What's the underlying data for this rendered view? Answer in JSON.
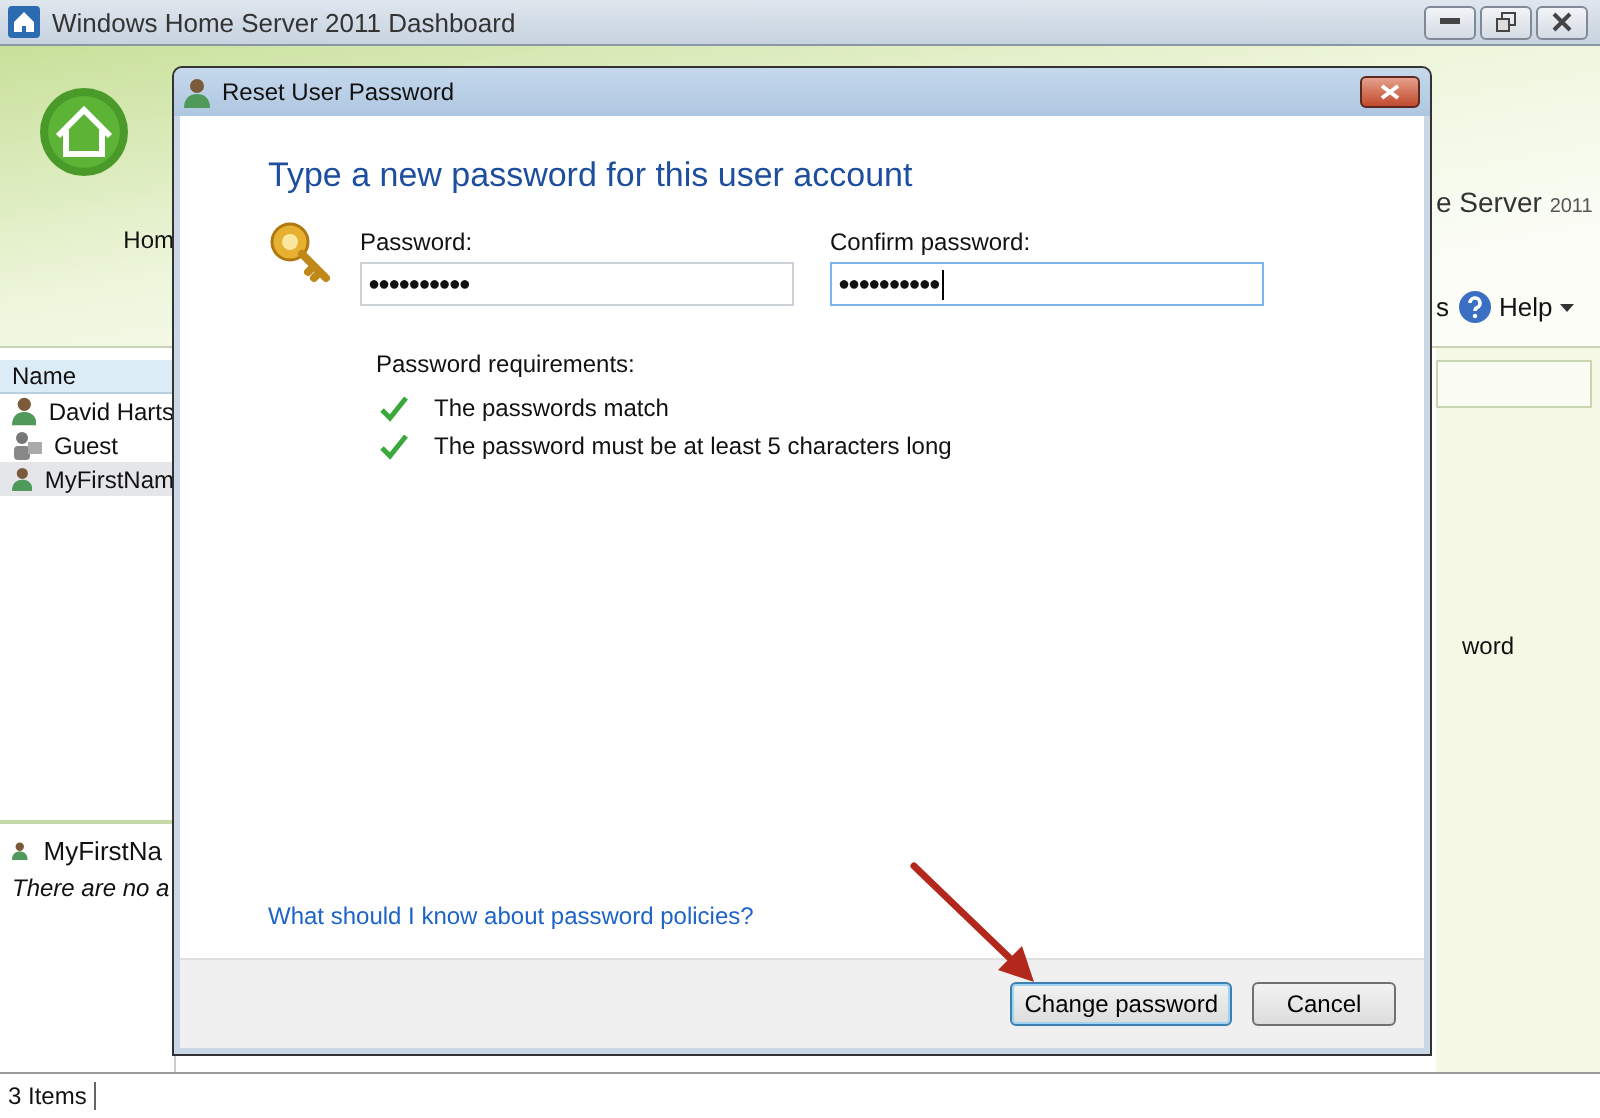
{
  "window": {
    "title": "Windows Home Server 2011 Dashboard"
  },
  "header": {
    "home_label": "Hom",
    "brand": "e Server",
    "brand_year": "2011",
    "toolbar_item": "s",
    "help": "Help"
  },
  "users_list": {
    "column": "Name",
    "rows": [
      {
        "name": "David Harts",
        "kind": "user",
        "selected": false
      },
      {
        "name": "Guest",
        "kind": "guest",
        "selected": false
      },
      {
        "name": "MyFirstNam",
        "kind": "user",
        "selected": true
      }
    ]
  },
  "details": {
    "name": "MyFirstNa",
    "note": "There are no a"
  },
  "tasks_pane": {
    "item": "word"
  },
  "status_bar": "3 Items",
  "dialog": {
    "title": "Reset User Password",
    "heading": "Type a new password for this user account",
    "fields": [
      {
        "label": "Password:",
        "value": "●●●●●●●●●●",
        "focused": false
      },
      {
        "label": "Confirm password:",
        "value": "●●●●●●●●●●",
        "focused": true
      }
    ],
    "requirements_title": "Password requirements:",
    "requirements": [
      {
        "text": "The passwords match",
        "met": true
      },
      {
        "text": "The password must be at least 5 characters long",
        "met": true
      }
    ],
    "link": "What should I know about password policies?",
    "buttons": [
      {
        "label": "Change password",
        "default": true
      },
      {
        "label": "Cancel",
        "default": false
      }
    ]
  }
}
